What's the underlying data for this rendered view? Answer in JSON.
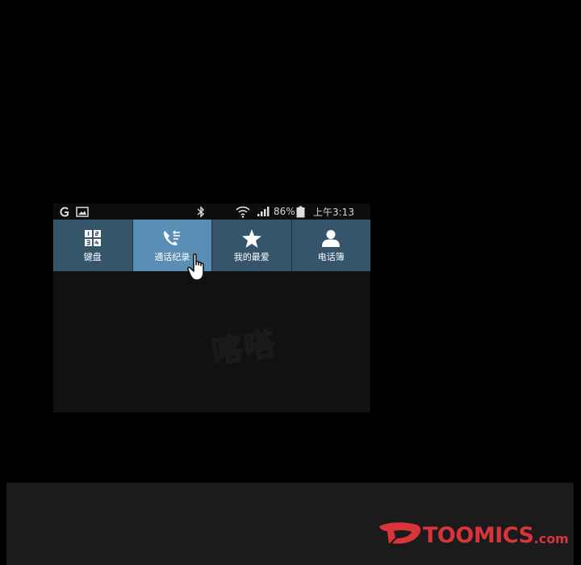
{
  "statusbar": {
    "battery_percent": "86%",
    "time": "上午3:13"
  },
  "tabs": [
    {
      "label": "键盘",
      "icon": "keypad-icon",
      "active": false
    },
    {
      "label": "通话纪录",
      "icon": "call-log-icon",
      "active": true
    },
    {
      "label": "我的最爱",
      "icon": "star-icon",
      "active": false
    },
    {
      "label": "电话簿",
      "icon": "contact-icon",
      "active": false
    }
  ],
  "sound_effect": "喀嗒",
  "watermark": {
    "brand": "TOOMICS",
    "domain": ".com",
    "color": "#d9343a"
  },
  "colors": {
    "tab_bg": "#35556b",
    "tab_active_bg": "#5b8eb5",
    "screen_bg": "#111111"
  }
}
